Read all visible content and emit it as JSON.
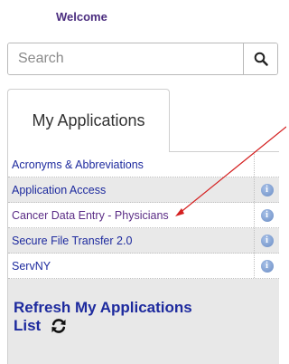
{
  "header": {
    "welcome": "Welcome"
  },
  "search": {
    "placeholder": "Search",
    "button_icon": "search-icon"
  },
  "tabs": [
    {
      "label": "My Applications"
    }
  ],
  "applications": {
    "items": [
      {
        "label": "Acronyms & Abbreviations",
        "info": false
      },
      {
        "label": "Application Access",
        "info": true
      },
      {
        "label": "Cancer Data Entry - Physicians",
        "info": true
      },
      {
        "label": "Secure File Transfer 2.0",
        "info": true
      },
      {
        "label": "ServNY",
        "info": true
      }
    ],
    "info_icon": "info-icon"
  },
  "refresh": {
    "line1": "Refresh My Applications",
    "line2": "List",
    "icon": "refresh-icon"
  },
  "colors": {
    "link": "#1d2a9e",
    "welcome": "#4b2d7f",
    "annotation_arrow": "#d42020"
  }
}
